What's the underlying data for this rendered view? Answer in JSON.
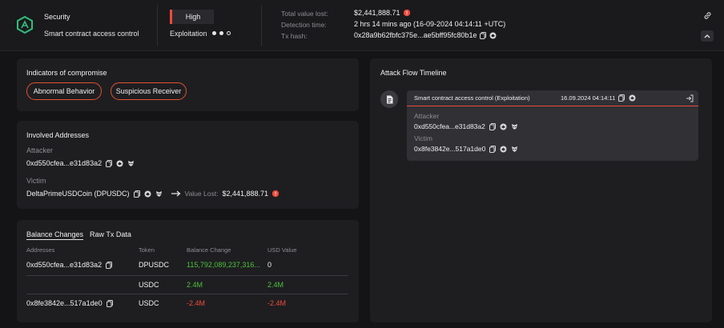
{
  "header": {
    "category_label": "Security",
    "category_sub": "Smart contract access control",
    "severity": "High",
    "stage_label": "Exploitation",
    "stage_dots": 3,
    "stage_filled": 2,
    "total_value_lost_label": "Total value lost:",
    "total_value_lost": "$2,441,888.71",
    "detection_time_label": "Detection time:",
    "detection_time": "2 hrs 14 mins ago (16-09-2024 04:14:11 +UTC)",
    "tx_hash_label": "Tx hash:",
    "tx_hash": "0x28a9b62fbfc375e...ae5bff95fc80b1e"
  },
  "indicators": {
    "title": "Indicators of compromise",
    "tags": [
      "Abnormal Behavior",
      "Suspicious Receiver"
    ]
  },
  "involved": {
    "title": "Involved Addresses",
    "attacker_label": "Attacker",
    "attacker_address": "0xd550cfea...e31d83a2",
    "victim_label": "Victim",
    "victim_name": "DeltaPrimeUSDCoin (DPUSDC)",
    "value_lost_label": "Value Lost:",
    "value_lost": "$2,441,888.71"
  },
  "balance": {
    "tabs": [
      "Balance Changes",
      "Raw Tx Data"
    ],
    "columns": [
      "Addresses",
      "Token",
      "Balance Change",
      "USD Value"
    ],
    "rows": [
      {
        "address": "0xd550cfea...e31d83a2",
        "token": "DPUSDC",
        "change": "115,792,089,237,316...",
        "usd": "0",
        "change_color": "#4cc13a",
        "usd_color": "#e6e6e6"
      },
      {
        "address": "",
        "token": "USDC",
        "change": "2.4M",
        "usd": "2.4M",
        "change_color": "#4cc13a",
        "usd_color": "#4cc13a"
      },
      {
        "address": "0x8fe3842e...517a1de0",
        "token": "USDC",
        "change": "-2.4M",
        "usd": "-2.4M",
        "change_color": "#ef4a3a",
        "usd_color": "#ef4a3a"
      }
    ]
  },
  "timeline": {
    "title": "Attack Flow Timeline",
    "event_title": "Smart contract access control (Exploitation)",
    "event_time": "16.09.2024 04:14:11",
    "attacker_label": "Attacker",
    "attacker_address": "0xd550cfea...e31d83a2",
    "victim_label": "Victim",
    "victim_address": "0x8fe3842e...517a1de0"
  },
  "colors": {
    "accent_red": "#ef4a3a",
    "accent_orange": "#e0532f",
    "green": "#4cc13a",
    "logo_green": "#2fbf7a"
  }
}
